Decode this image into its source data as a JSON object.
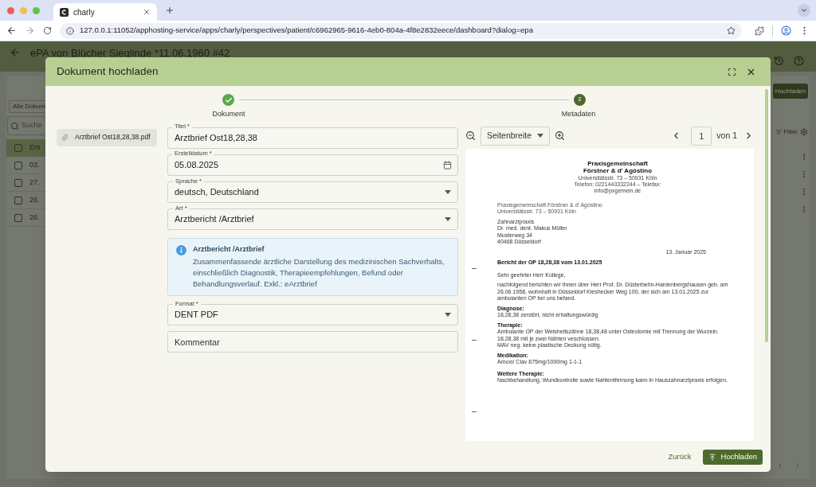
{
  "browser": {
    "tab_title": "charly",
    "url": "127.0.0.1:11052/apphosting-service/apps/charly/perspectives/patient/c6962965-9616-4eb0-804a-4f8e2832eece/dashboard?dialog=epa"
  },
  "background": {
    "title": "ePA von Blücher Sieglinde *11.06.1960 #42",
    "filter_select": "Alle Dokum",
    "search_placeholder": "Suche",
    "column_1": "Ers",
    "rows": [
      {
        "cell": "03.",
        "checked": false
      },
      {
        "cell": "27.",
        "checked": false
      },
      {
        "cell": "26.",
        "checked": false
      },
      {
        "cell": "26.",
        "checked": false
      }
    ],
    "upload_button": "Hochladen",
    "filter_button": "Filter"
  },
  "dialog": {
    "title": "Dokument hochladen",
    "steps": [
      {
        "label": "Dokument",
        "done": true,
        "active": false
      },
      {
        "label": "Metadaten",
        "done": false,
        "active": true,
        "number": "2"
      }
    ],
    "attachments": [
      {
        "name": "Arztbrief Ost18,28,38.pdf",
        "selected": true
      }
    ],
    "fields": [
      {
        "kind": "text",
        "label": "Titel *",
        "value": "Arztbrief Ost18,28,38"
      },
      {
        "kind": "date",
        "label": "Erstelldatum *",
        "value": "05.08.2025"
      },
      {
        "kind": "select",
        "label": "Sprache *",
        "value": "deutsch, Deutschland"
      },
      {
        "kind": "select",
        "label": "Art *",
        "value": "Arztbericht /Arztbrief"
      },
      {
        "kind": "info",
        "title": "Arztbericht /Arztbrief",
        "text": "Zusammenfassende ärztliche Darstellung des medizinischen Sachverhalts, einschließlich Diagnostik, Therapieempfehlungen, Befund oder Behandlungsverlauf. Exkl.: eArztbrief"
      },
      {
        "kind": "select",
        "label": "Format *",
        "value": "DENT PDF"
      },
      {
        "kind": "text",
        "placeholder": "Kommentar"
      }
    ],
    "viewer": {
      "zoom": "Seitenbreite",
      "page": "1",
      "page_count": "von 1",
      "document": {
        "letterhead": [
          "Praxisgemeinschaft",
          "Förstner & d' Agóstino"
        ],
        "contact": [
          "Universitätsstr. 73 – 50931 Köln",
          "Telefon: 0221443332244 – Telefax:",
          "info@pxgemein.de"
        ],
        "sender": [
          "Praxisgemeinschaft Förstner & d' Agóstino",
          "Universitätsstr. 73 – 50931 Köln"
        ],
        "recipient": [
          "Zahnarztpraxis",
          "Dr. med. dent. Makus Müller",
          "Musterweg 34",
          "40468 Düsseldorf"
        ],
        "date": "13. Januar 2025",
        "subject": "Bericht der OP 18,28,38 vom 13.01.2025",
        "salutation": "Sehr geehrter Herr Kollege,",
        "intro": "nachfolgend berichten wir Ihnen über Herr Prof. Dr. Düsterbehn-Hardenbergshausen geb. am 26.06.1958, wohnhaft in Düsseldorf Kieshecker Weg 100, der sich am 13.01.2025 zur ambulanten OP bei uns befand.",
        "sections": [
          {
            "heading": "Diagnose:",
            "lines": [
              "18,28,38 zerstört, nicht erhaltungswürdig"
            ]
          },
          {
            "heading": "Therapie:",
            "lines": [
              "Ambulante OP der Weisheitszähne 18,38,48 unter Osteotomie mit Trennung der Wurzeln.",
              "18,28,38 mit je zwei Nähten veschlossen.",
              "MAV neg. keine plastische Deckung nötig."
            ]
          },
          {
            "heading": "Medikation:",
            "lines": [
              "Amoxi/ Clav 875mg/1000mg 1-1-1"
            ]
          },
          {
            "heading": "Weitere Therapie:",
            "lines": [
              "Nachbehandlung, Wundkontrolle sowie Nahtentfernung kann in Hauszahnarztpraxis erfolgen."
            ]
          }
        ]
      }
    },
    "back_button": "Zurück",
    "upload_button": "Hochladen"
  }
}
